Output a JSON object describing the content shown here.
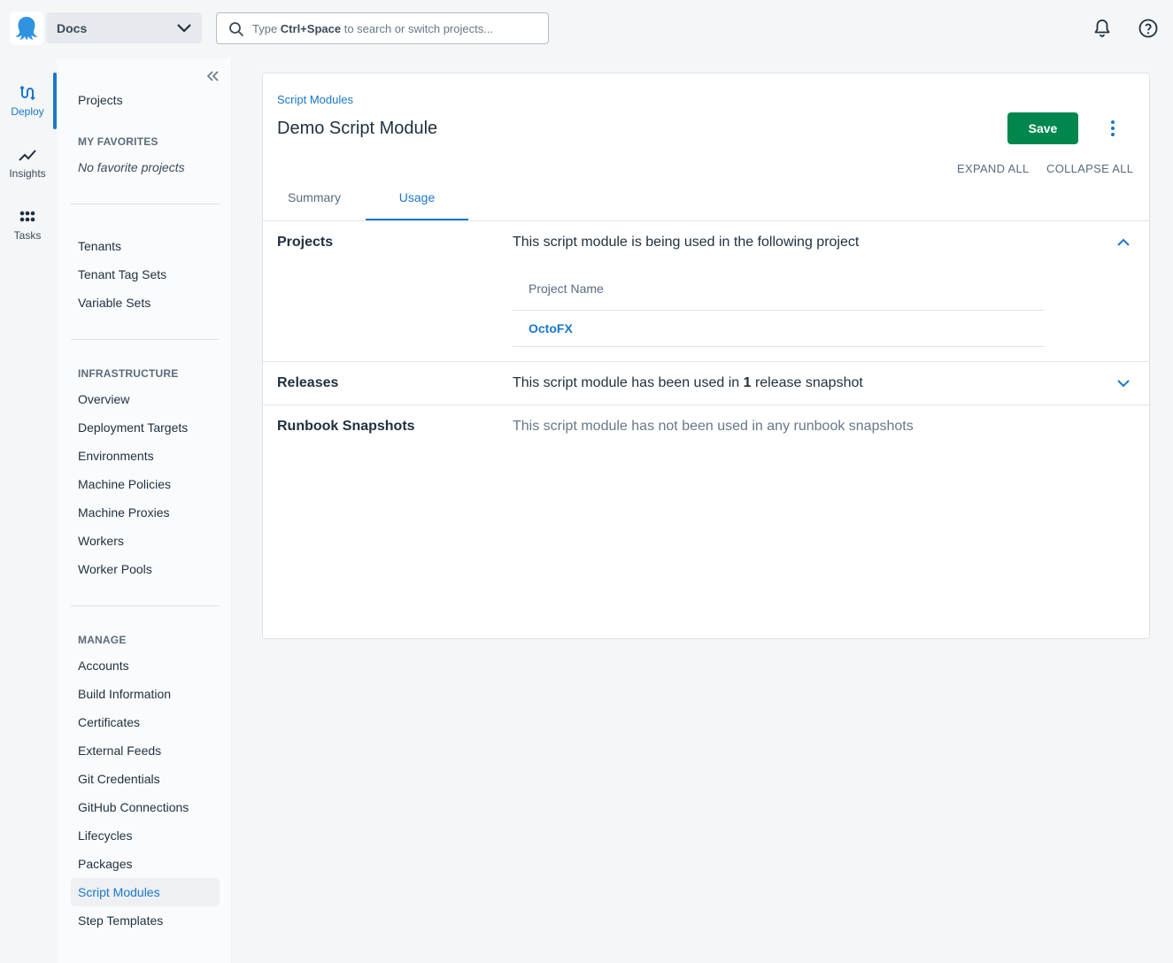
{
  "topbar": {
    "space_name": "Docs",
    "search_prefix": "Type ",
    "search_shortcut": "Ctrl+Space",
    "search_suffix": " to search or switch projects..."
  },
  "rail": [
    {
      "label": "Deploy",
      "icon": "deploy-icon",
      "active": true
    },
    {
      "label": "Insights",
      "icon": "insights-icon"
    },
    {
      "label": "Tasks",
      "icon": "tasks-icon"
    }
  ],
  "sidebar": {
    "projects": "Projects",
    "favorites_heading": "MY FAVORITES",
    "favorites_empty": "No favorite projects",
    "group1": [
      "Tenants",
      "Tenant Tag Sets",
      "Variable Sets"
    ],
    "infrastructure_heading": "INFRASTRUCTURE",
    "infrastructure": [
      "Overview",
      "Deployment Targets",
      "Environments",
      "Machine Policies",
      "Machine Proxies",
      "Workers",
      "Worker Pools"
    ],
    "manage_heading": "MANAGE",
    "manage": [
      "Accounts",
      "Build Information",
      "Certificates",
      "External Feeds",
      "Git Credentials",
      "GitHub Connections",
      "Lifecycles",
      "Packages",
      "Script Modules",
      "Step Templates"
    ],
    "active_item": "Script Modules"
  },
  "main": {
    "breadcrumb": "Script Modules",
    "title": "Demo Script Module",
    "save_label": "Save",
    "expand_all": "EXPAND ALL",
    "collapse_all": "COLLAPSE ALL",
    "tabs": [
      {
        "label": "Summary",
        "active": false
      },
      {
        "label": "Usage",
        "active": true
      }
    ],
    "sections": {
      "projects": {
        "title": "Projects",
        "description": "This script module is being used in the following project",
        "column_header": "Project Name",
        "rows": [
          "OctoFX"
        ]
      },
      "releases": {
        "title": "Releases",
        "desc_prefix": "This script module has been used in ",
        "desc_count": "1",
        "desc_suffix": " release snapshot"
      },
      "runbooks": {
        "title": "Runbook Snapshots",
        "description": "This script module has not been used in any runbook snapshots"
      }
    }
  },
  "colors": {
    "accent": "#1a77ca",
    "save_green": "#00874e"
  }
}
